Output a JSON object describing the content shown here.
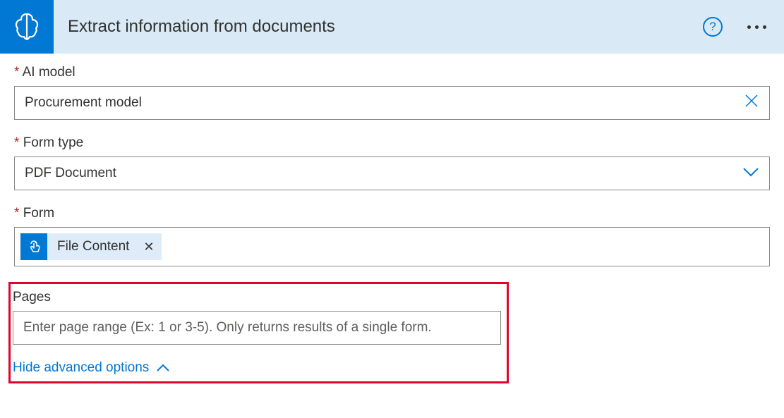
{
  "header": {
    "title": "Extract information from documents",
    "help_glyph": "?"
  },
  "fields": {
    "ai_model": {
      "label": "AI model",
      "value": "Procurement model"
    },
    "form_type": {
      "label": "Form type",
      "value": "PDF Document"
    },
    "form": {
      "label": "Form",
      "token_label": "File Content"
    },
    "pages": {
      "label": "Pages",
      "placeholder": "Enter page range (Ex: 1 or 3-5). Only returns results of a single form."
    }
  },
  "advanced_toggle": "Hide advanced options"
}
